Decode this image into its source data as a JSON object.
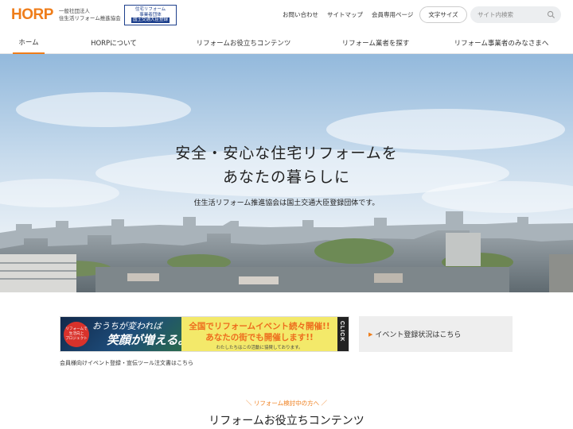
{
  "header": {
    "logo_text": "HORP",
    "org_line1": "一般社団法人",
    "org_line2": "住生活リフォーム推進協会",
    "badge": {
      "line1": "住宅リフォーム",
      "line2": "事業者団体",
      "line3": "国土交通大臣登録"
    },
    "links": [
      "お問い合わせ",
      "サイトマップ",
      "会員専用ページ"
    ],
    "font_size_button": "文字サイズ",
    "search_placeholder": "サイト内検索"
  },
  "nav": {
    "items": [
      "ホーム",
      "HORPについて",
      "リフォームお役立ちコンテンツ",
      "リフォーム業者を探す",
      "リフォーム事業者のみなさまへ"
    ],
    "active_index": 0
  },
  "hero": {
    "title_line1": "安全・安心な住宅リフォームを",
    "title_line2": "あなたの暮らしに",
    "subtitle": "住生活リフォーム推進協会は国土交通大臣登録団体です。"
  },
  "banner": {
    "circle_line1": "リフォームで",
    "circle_line2": "生活向上",
    "circle_line3": "プロジェクト",
    "slogan1": "おうちが変われば",
    "slogan2": "笑顔が増える。",
    "headline1": "全国でリフォームイベント続々開催!!",
    "headline2": "あなたの街でも開催します!!",
    "note": "わたしたちはこの活動に協賛しております。",
    "click": "CLICK",
    "caption": "会員様向けイベント登録・宣伝ツール注文書はこちら"
  },
  "event_status": {
    "label": "イベント登録状況はこちら"
  },
  "section": {
    "eyebrow": "＼ リフォーム検討中の方へ ／",
    "title": "リフォームお役立ちコンテンツ"
  },
  "colors": {
    "accent": "#ef7d1a",
    "badge_blue": "#1d3f8c",
    "banner_yellow": "#f3e96a",
    "event_bg": "#eeeeee"
  }
}
